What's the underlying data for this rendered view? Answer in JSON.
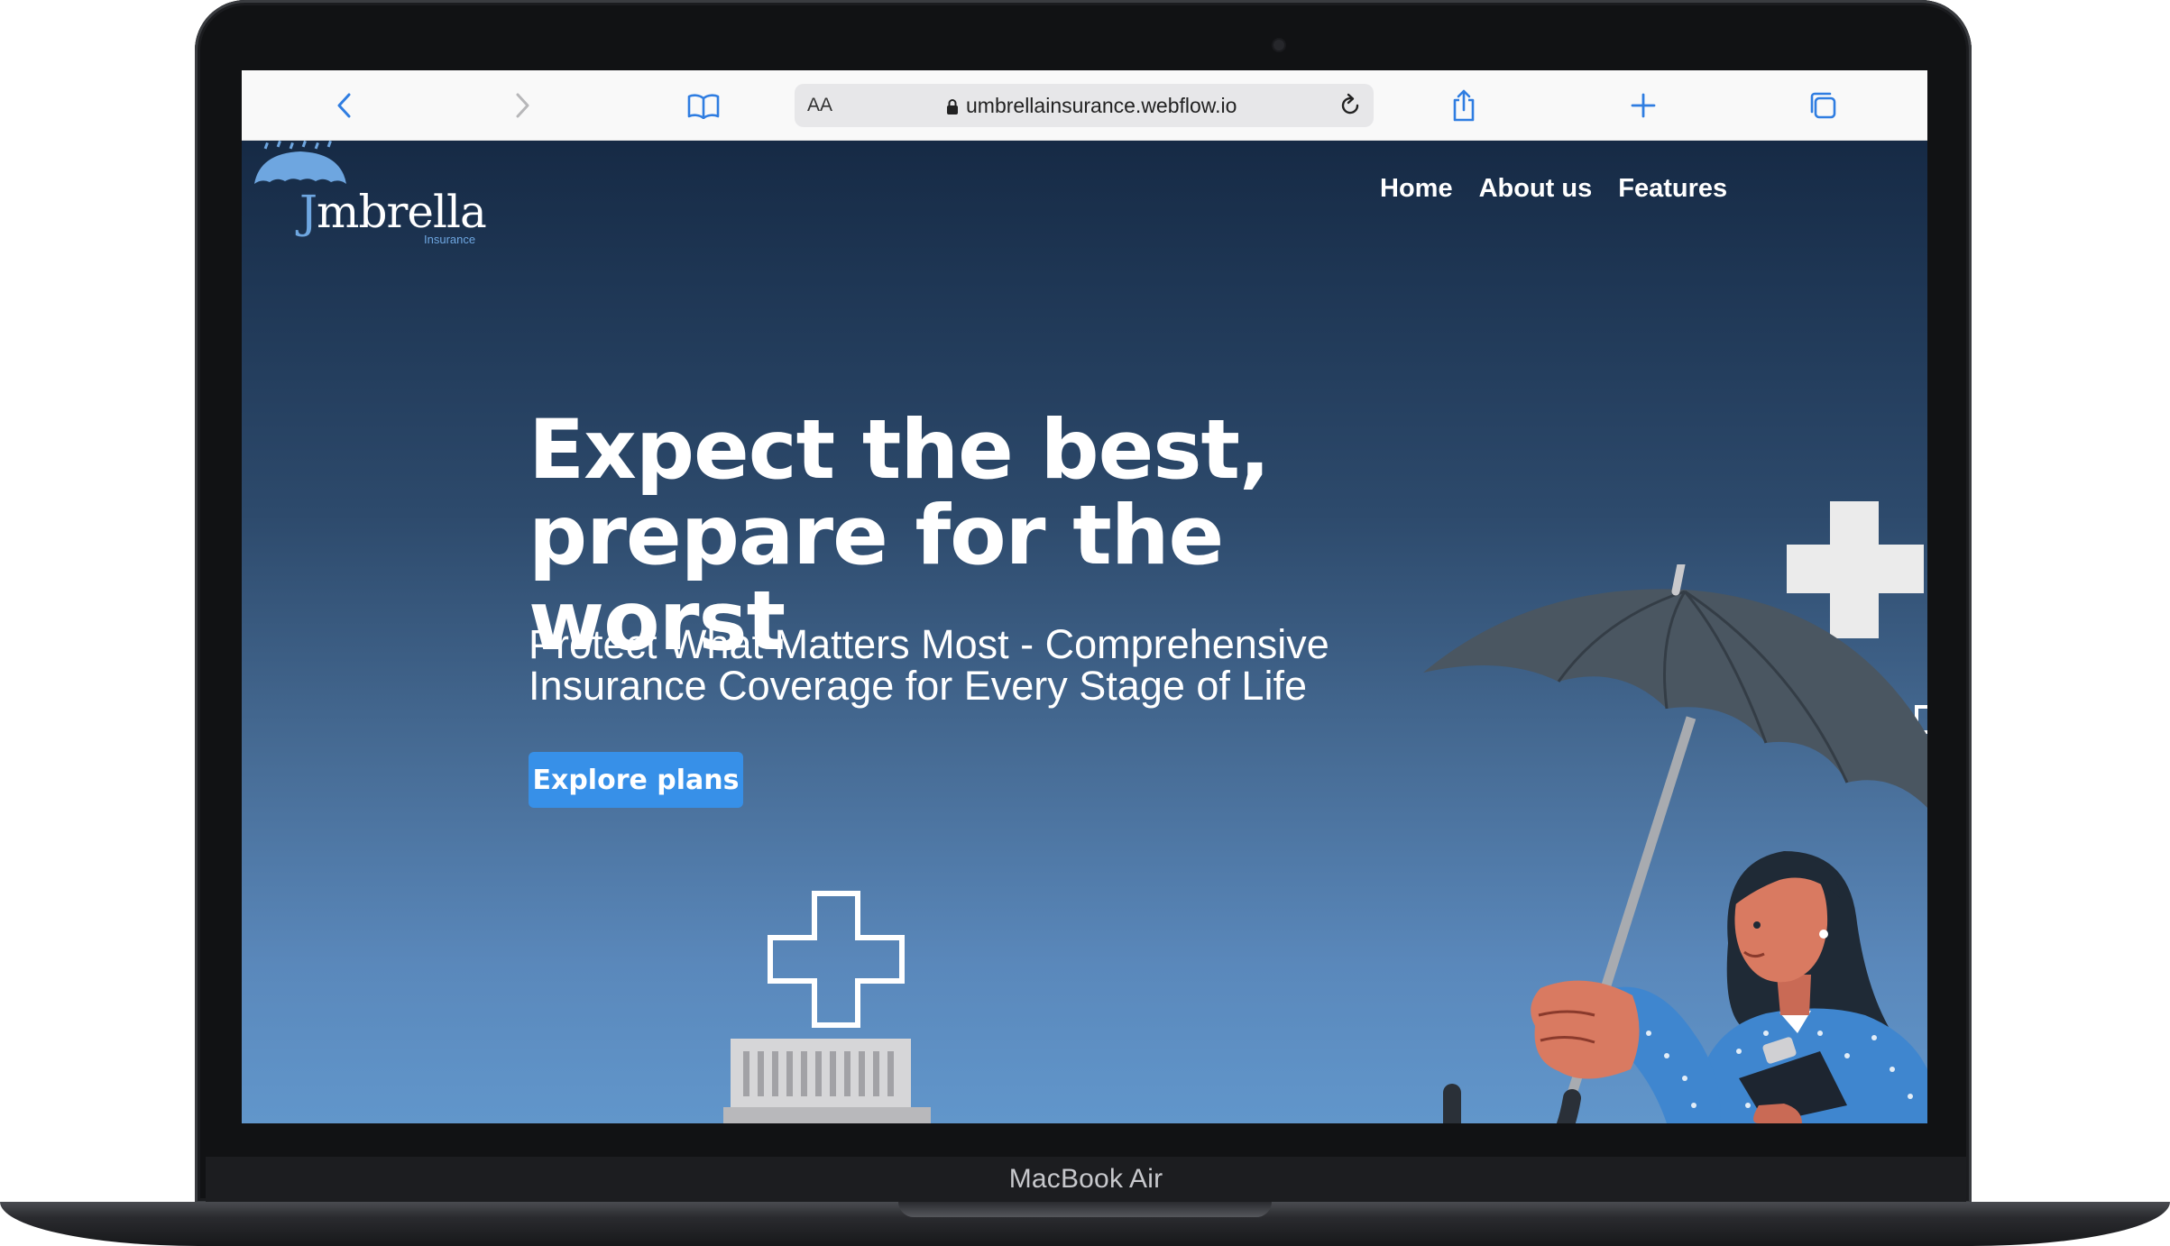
{
  "device": {
    "label": "MacBook Air"
  },
  "browser": {
    "text_size_label": "AA",
    "url": "umbrellainsurance.webflow.io",
    "icons": [
      "back-icon",
      "forward-icon",
      "bookmarks-icon",
      "lock-icon",
      "reload-icon",
      "share-icon",
      "new-tab-icon",
      "tabs-icon"
    ]
  },
  "site": {
    "logo_text_initial": "J",
    "logo_text_rest": "mbrella",
    "logo_sub": "Insurance",
    "nav": [
      "Home",
      "About us",
      "Features"
    ],
    "headline": [
      "Expect the best,",
      "prepare for the worst"
    ],
    "subhead": "Protect What Matters Most - Comprehensive Insurance Coverage for Every Stage of Life",
    "cta_label": "Explore plans",
    "colors": {
      "accent": "#3790e8",
      "logo_blue": "#6ea6e0",
      "gradient_top": "#162a45",
      "gradient_bottom": "#6196cb"
    }
  }
}
